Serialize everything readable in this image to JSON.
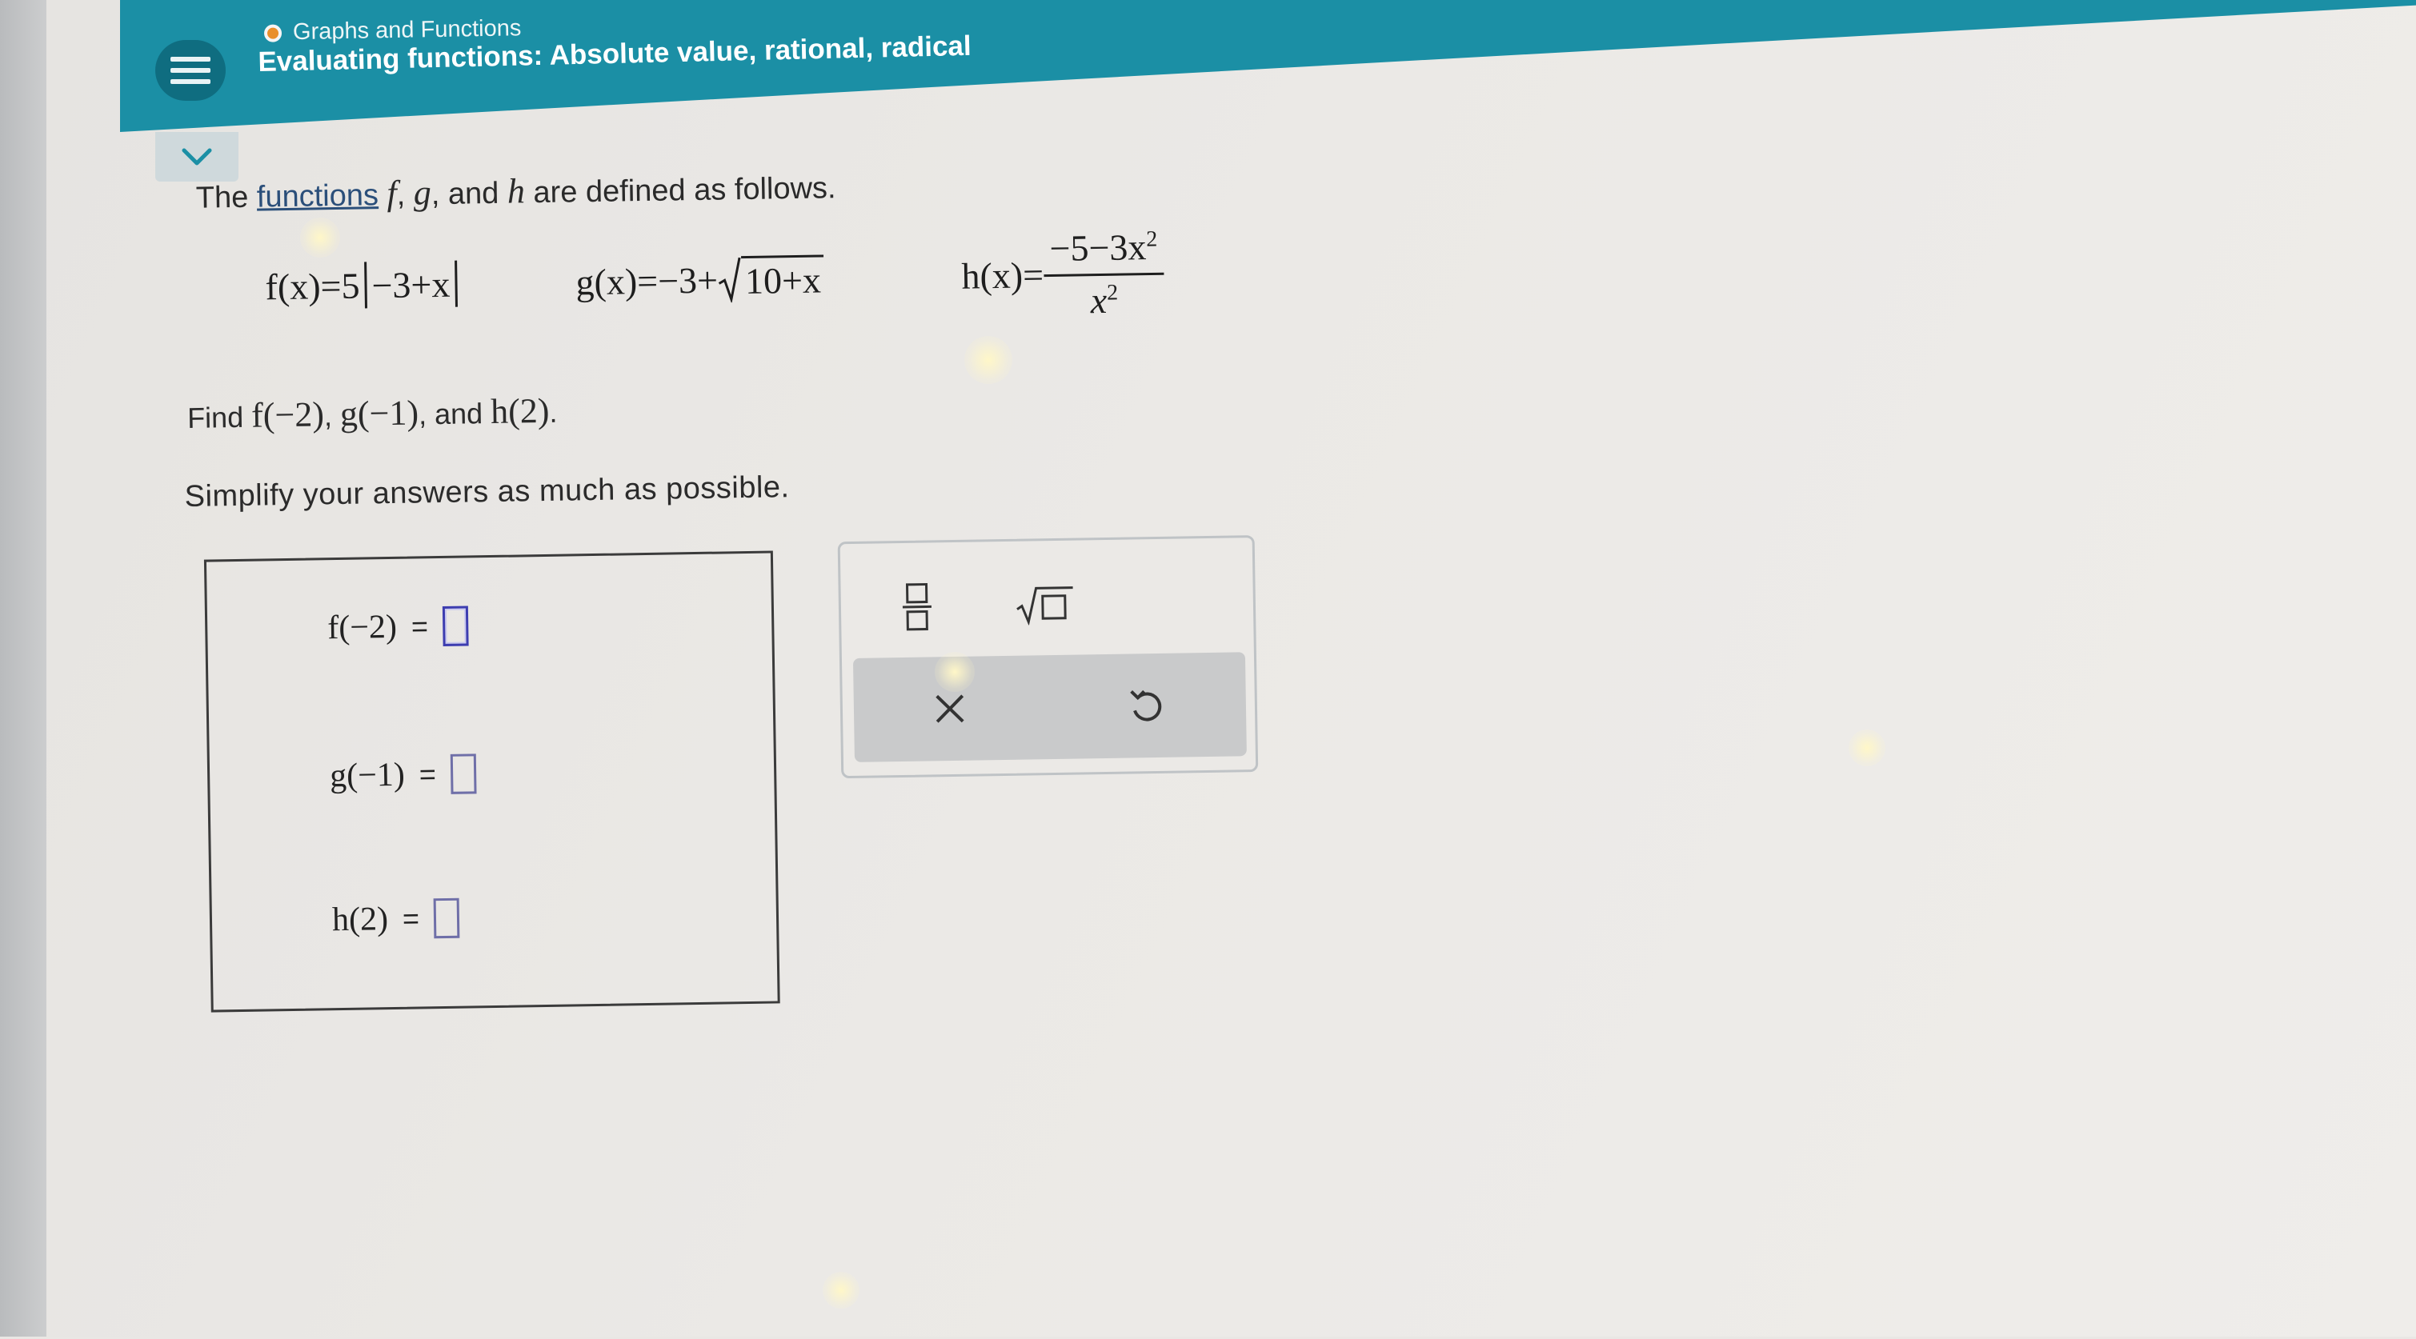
{
  "header": {
    "topic": "Graphs and Functions",
    "title": "Evaluating functions: Absolute value, rational, radical"
  },
  "problem": {
    "intro_pre": "The",
    "intro_link": "functions",
    "intro_f": "f",
    "intro_g": "g",
    "intro_and": "and",
    "intro_h": "h",
    "intro_post": "are defined as follows.",
    "f_def_lhs": "f(x)=5",
    "f_def_inner": "−3+x",
    "g_def_lhs": "g(x)=−3+",
    "g_def_rad": "10+x",
    "h_def_lhs": "h(x)=",
    "h_def_num": "−5−3x",
    "h_def_num_exp": "2",
    "h_def_den": "x",
    "h_def_den_exp": "2",
    "find_label": "Find",
    "find_f": "f(−2)",
    "find_g": "g(−1)",
    "find_and": "and",
    "find_h": "h(2)",
    "simplify": "Simplify your answers as much as possible."
  },
  "answers": {
    "f_label": "f(−2)",
    "g_label": "g(−1)",
    "h_label": "h(2)",
    "equals": "=",
    "f_value": "",
    "g_value": "",
    "h_value": ""
  },
  "palette": {
    "fraction_icon": "fraction-icon",
    "sqrt_icon": "square-root-icon",
    "clear_icon": "close-icon",
    "undo_icon": "undo-icon"
  },
  "colors": {
    "header": "#1b8fa5",
    "menu_button": "#0f6d80",
    "input_border": "#6f6fa8"
  }
}
